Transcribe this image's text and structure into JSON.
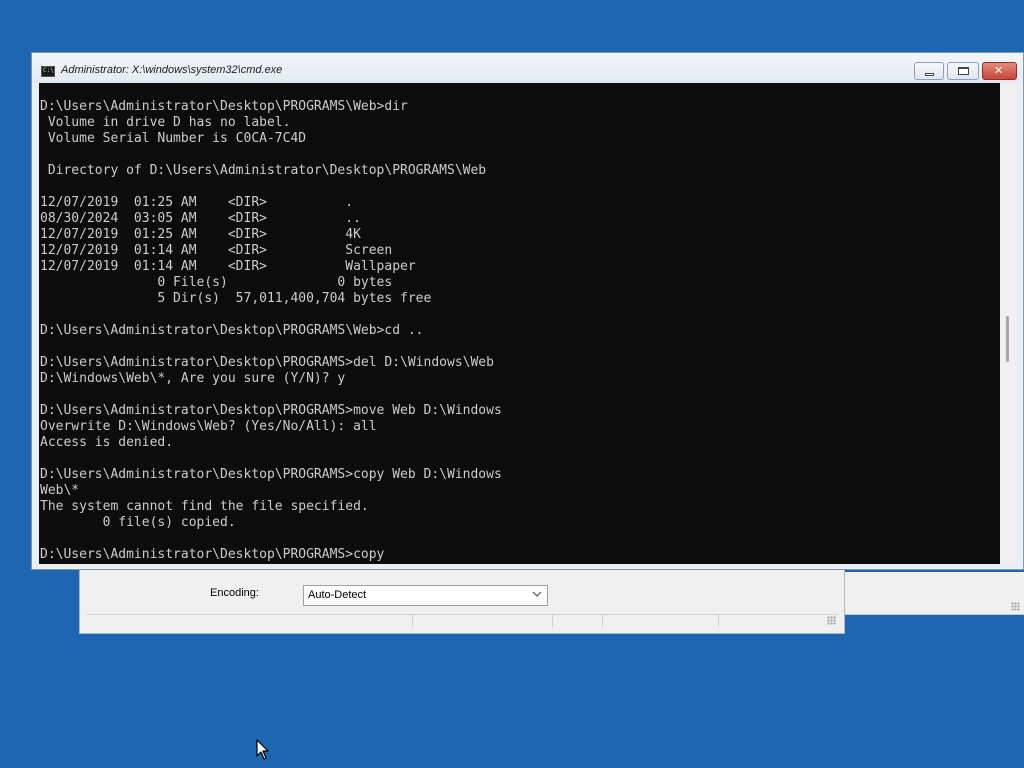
{
  "desktop": {
    "background_color": "#1f66b2"
  },
  "background_dialog": {
    "encoding_label": "Encoding:",
    "encoding_value": "Auto-Detect",
    "chevron_icon": "chevron-down-icon"
  },
  "cmd_window": {
    "title": "Administrator: X:\\windows\\system32\\cmd.exe",
    "icon": "cmd-icon",
    "icon_text": "C:\\",
    "buttons": {
      "minimize": "minimize-icon",
      "maximize": "maximize-icon",
      "close": "✕"
    },
    "console_lines": [
      "D:\\Users\\Administrator\\Desktop\\PROGRAMS\\Web>dir",
      " Volume in drive D has no label.",
      " Volume Serial Number is C0CA-7C4D",
      "",
      " Directory of D:\\Users\\Administrator\\Desktop\\PROGRAMS\\Web",
      "",
      "12/07/2019  01:25 AM    <DIR>          .",
      "08/30/2024  03:05 AM    <DIR>          ..",
      "12/07/2019  01:25 AM    <DIR>          4K",
      "12/07/2019  01:14 AM    <DIR>          Screen",
      "12/07/2019  01:14 AM    <DIR>          Wallpaper",
      "               0 File(s)              0 bytes",
      "               5 Dir(s)  57,011,400,704 bytes free",
      "",
      "D:\\Users\\Administrator\\Desktop\\PROGRAMS\\Web>cd ..",
      "",
      "D:\\Users\\Administrator\\Desktop\\PROGRAMS>del D:\\Windows\\Web",
      "D:\\Windows\\Web\\*, Are you sure (Y/N)? y",
      "",
      "D:\\Users\\Administrator\\Desktop\\PROGRAMS>move Web D:\\Windows",
      "Overwrite D:\\Windows\\Web? (Yes/No/All): all",
      "Access is denied.",
      "",
      "D:\\Users\\Administrator\\Desktop\\PROGRAMS>copy Web D:\\Windows",
      "Web\\*",
      "The system cannot find the file specified.",
      "        0 file(s) copied.",
      "",
      "D:\\Users\\Administrator\\Desktop\\PROGRAMS>copy"
    ]
  },
  "cursor": {
    "icon": "mouse-pointer-icon"
  }
}
